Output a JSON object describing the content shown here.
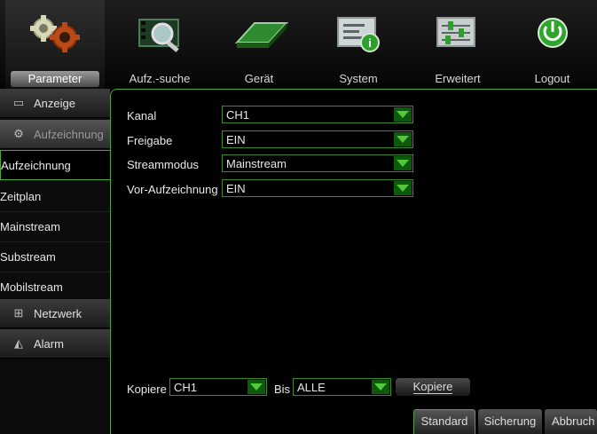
{
  "tabs": [
    {
      "label": "Parameter",
      "icon": "gears-icon",
      "active": true
    },
    {
      "label": "Aufz.-suche",
      "icon": "film-search-icon",
      "active": false
    },
    {
      "label": "Gerät",
      "icon": "hard-drive-icon",
      "active": false
    },
    {
      "label": "System",
      "icon": "system-info-icon",
      "active": false
    },
    {
      "label": "Erweitert",
      "icon": "sliders-icon",
      "active": false
    },
    {
      "label": "Logout",
      "icon": "power-icon",
      "active": false
    }
  ],
  "sidebar": {
    "categories": {
      "anzeige": {
        "label": "Anzeige",
        "icon": "monitor-icon"
      },
      "aufzeichnung": {
        "label": "Aufzeichnung",
        "icon": "record-icon"
      },
      "netzwerk": {
        "label": "Netzwerk",
        "icon": "network-icon"
      },
      "alarm": {
        "label": "Alarm",
        "icon": "alarm-icon"
      }
    },
    "subitems": [
      "Aufzeichnung",
      "Zeitplan",
      "Mainstream",
      "Substream",
      "Mobilstream"
    ]
  },
  "form": {
    "kanal": {
      "label": "Kanal",
      "value": "CH1"
    },
    "freigabe": {
      "label": "Freigabe",
      "value": "EIN"
    },
    "streammodus": {
      "label": "Streammodus",
      "value": "Mainstream"
    },
    "vor_aufzeichnung": {
      "label": "Vor-Aufzeichnung",
      "value": "EIN"
    }
  },
  "copy": {
    "label": "Kopiere",
    "from_value": "CH1",
    "bis_label": "Bis",
    "to_value": "ALLE",
    "button_label": "Kopiere"
  },
  "footer": {
    "standard": "Standard",
    "sicherung": "Sicherung",
    "abbruch": "Abbruch"
  },
  "colors": {
    "accent": "#4ea934",
    "arrow_green": "#52c83a"
  }
}
